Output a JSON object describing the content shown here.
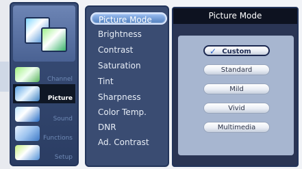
{
  "sidebar": {
    "items": [
      {
        "label": "Channel"
      },
      {
        "label": "Picture"
      },
      {
        "label": "Sound"
      },
      {
        "label": "Functions"
      },
      {
        "label": "Setup"
      }
    ]
  },
  "menu": {
    "items": [
      {
        "label": "Picture Mode"
      },
      {
        "label": "Brightness"
      },
      {
        "label": "Contrast"
      },
      {
        "label": "Saturation"
      },
      {
        "label": "Tint"
      },
      {
        "label": "Sharpness"
      },
      {
        "label": "Color Temp."
      },
      {
        "label": "DNR"
      },
      {
        "label": "Ad. Contrast"
      }
    ]
  },
  "panel": {
    "title": "Picture Mode",
    "options": [
      {
        "label": "Custom"
      },
      {
        "label": "Standard"
      },
      {
        "label": "Mild"
      },
      {
        "label": "Vivid"
      },
      {
        "label": "Multimedia"
      }
    ],
    "selected_index": 0
  },
  "colors": {
    "sidebar_bg": "#2b3d63",
    "menu_bg": "#3a4c72",
    "panel_bg": "#2a3554",
    "accent": "#4e7dbd"
  },
  "icons": {
    "logo": "tv-screens-icon",
    "channel": "channel-icon",
    "picture": "picture-icon",
    "sound": "sound-icon",
    "functions": "functions-icon",
    "setup": "setup-icon",
    "check": "checkmark-icon"
  }
}
